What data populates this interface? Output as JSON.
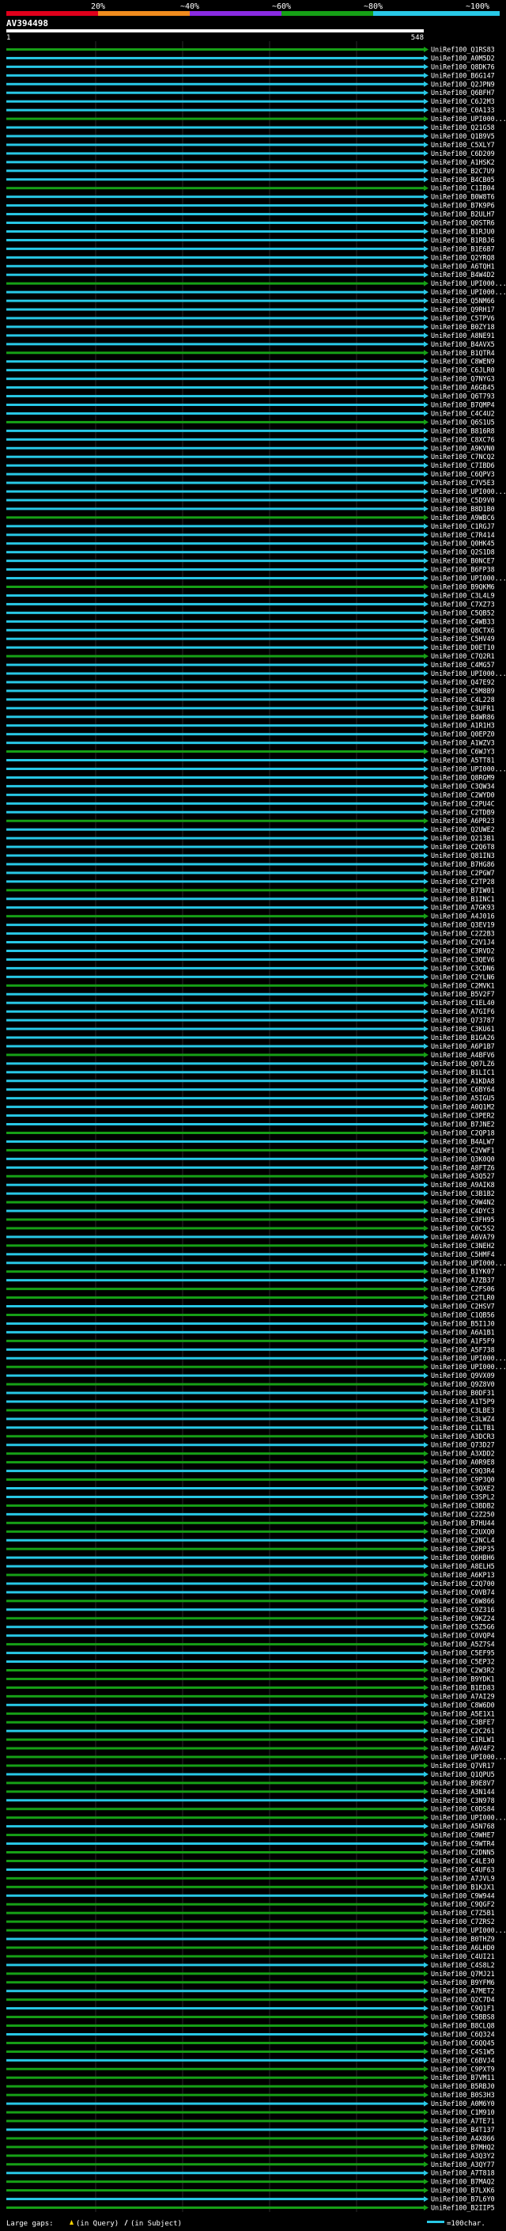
{
  "chart_data": {
    "type": "alignment-overview",
    "query_id": "AV394498",
    "query_start": "1",
    "query_end": "548",
    "identity_scale": {
      "labels": [
        "20%",
        "~40%",
        "~60%",
        "~80%",
        "~100%"
      ],
      "colors": [
        "#e0001b",
        "#f08c1e",
        "#8a2be2",
        "#16a016",
        "#28c8e6"
      ]
    },
    "footer": {
      "large_gaps_label": "Large gaps:",
      "gap_query_label": "(in Query)",
      "gap_subject_label": "(in Subject)",
      "scale_note": "=100char."
    },
    "subjects": [
      "UniRef100_Q1RS83",
      "UniRef100_A0M5D2",
      "UniRef100_Q8DK76",
      "UniRef100_B6G147",
      "UniRef100_Q2JPN9",
      "UniRef100_Q6BFH7",
      "UniRef100_C6J2M3",
      "UniRef100_C0A133",
      "UniRef100_UPI000...",
      "UniRef100_Q21G58",
      "UniRef100_Q1B9V5",
      "UniRef100_C5XLY7",
      "UniRef100_C6D209",
      "UniRef100_A1HSK2",
      "UniRef100_B2C7U9",
      "UniRef100_B4CB05",
      "UniRef100_C1IB04",
      "UniRef100_B0W8T6",
      "UniRef100_B7K9P6",
      "UniRef100_B2ULH7",
      "UniRef100_Q0STR6",
      "UniRef100_B1RJU0",
      "UniRef100_B1RBJ6",
      "UniRef100_B1E6B7",
      "UniRef100_Q2YRQ8",
      "UniRef100_A6TQH1",
      "UniRef100_B4W4D2",
      "UniRef100_UPI000...",
      "UniRef100_UPI000...",
      "UniRef100_Q5NM66",
      "UniRef100_Q9RH17",
      "UniRef100_C5TPV6",
      "UniRef100_B0ZY18",
      "UniRef100_A8NE91",
      "UniRef100_B4AVX5",
      "UniRef100_B1QTR4",
      "UniRef100_C8WEN9",
      "UniRef100_C6JLR0",
      "UniRef100_Q7NYG3",
      "UniRef100_A6GB45",
      "UniRef100_Q6T793",
      "UniRef100_B7QMP4",
      "UniRef100_C4C4U2",
      "UniRef100_Q6S1U5",
      "UniRef100_B816R8",
      "UniRef100_C8XC76",
      "UniRef100_A9KVN0",
      "UniRef100_C7NCQ2",
      "UniRef100_C7IBD6",
      "UniRef100_C6QPV3",
      "UniRef100_C7V5E3",
      "UniRef100_UPI000...",
      "UniRef100_C5D9V0",
      "UniRef100_B8D1B0",
      "UniRef100_A9WBC6",
      "UniRef100_C1RGJ7",
      "UniRef100_C7R414",
      "UniRef100_Q0HK45",
      "UniRef100_Q2S1D8",
      "UniRef100_B0NCE7",
      "UniRef100_B6FP38",
      "UniRef100_UPI000...",
      "UniRef100_B9QKM6",
      "UniRef100_C3L4L9",
      "UniRef100_C7XZ73",
      "UniRef100_C5QB52",
      "UniRef100_C4WB33",
      "UniRef100_Q8CTX6",
      "UniRef100_C5HV49",
      "UniRef100_D0ET10",
      "UniRef100_C7Q2R1",
      "UniRef100_C4MG57",
      "UniRef100_UPI000...",
      "UniRef100_Q47E92",
      "UniRef100_C5M8B9",
      "UniRef100_C4L228",
      "UniRef100_C3UFR1",
      "UniRef100_B4WR86",
      "UniRef100_A1R1H3",
      "UniRef100_Q0EPZ0",
      "UniRef100_A1WZV3",
      "UniRef100_C6WJY3",
      "UniRef100_A5TT81",
      "UniRef100_UPI000...",
      "UniRef100_Q8RGM9",
      "UniRef100_C3QW34",
      "UniRef100_C2WYD0",
      "UniRef100_C2PU4C",
      "UniRef100_C2TDB9",
      "UniRef100_A6PR23",
      "UniRef100_Q2UWE2",
      "UniRef100_Q213B1",
      "UniRef100_C2Q6T8",
      "UniRef100_Q81IN3",
      "UniRef100_B7HG86",
      "UniRef100_C2PGW7",
      "UniRef100_C2TP28",
      "UniRef100_B7IW01",
      "UniRef100_B1INC1",
      "UniRef100_A7GK93",
      "UniRef100_A4J016",
      "UniRef100_Q3EV19",
      "UniRef100_C2Z2B3",
      "UniRef100_C2V1J4",
      "UniRef100_C3RVD2",
      "UniRef100_C3QEV6",
      "UniRef100_C3CDN6",
      "UniRef100_C2YLN6",
      "UniRef100_C2MVK1",
      "UniRef100_B5V2F7",
      "UniRef100_C1EL40",
      "UniRef100_A7GIF6",
      "UniRef100_Q73787",
      "UniRef100_C3KU61",
      "UniRef100_B1GA26",
      "UniRef100_A6P1B7",
      "UniRef100_A4BFV6",
      "UniRef100_Q07LZ6",
      "UniRef100_B1LIC1",
      "UniRef100_A1KDA8",
      "UniRef100_C6BY64",
      "UniRef100_A5IGU5",
      "UniRef100_A0Q1M2",
      "UniRef100_C3PER2",
      "UniRef100_B7JNE2",
      "UniRef100_C2QP18",
      "UniRef100_B4ALW7",
      "UniRef100_C2VWF1",
      "UniRef100_Q3K0Q0",
      "UniRef100_A8FTZ6",
      "UniRef100_A3Q527",
      "UniRef100_A9AIK8",
      "UniRef100_C3B1B2",
      "UniRef100_C9W4N2",
      "UniRef100_C4DYC3",
      "UniRef100_C3FH95",
      "UniRef100_C0C5S2",
      "UniRef100_A6VA79",
      "UniRef100_C3NEH2",
      "UniRef100_C5HMF4",
      "UniRef100_UPI000...",
      "UniRef100_B1YK07",
      "UniRef100_A7ZB37",
      "UniRef100_C2FS06",
      "UniRef100_C2TLR0",
      "UniRef100_C2HSV7",
      "UniRef100_C1QB56",
      "UniRef100_B5I1J0",
      "UniRef100_A6A1B1",
      "UniRef100_A1F5F9",
      "UniRef100_A5F738",
      "UniRef100_UPI000...",
      "UniRef100_UPI000...",
      "UniRef100_Q9VX09",
      "UniRef100_Q9Z8V0",
      "UniRef100_B0DF31",
      "UniRef100_A1T5P9",
      "UniRef100_C3LBE3",
      "UniRef100_C3LWZ4",
      "UniRef100_C1LTB1",
      "UniRef100_A3DCR3",
      "UniRef100_Q73D27",
      "UniRef100_A3XDD2",
      "UniRef100_A0R9E8",
      "UniRef100_C9Q3R4",
      "UniRef100_C9P3Q0",
      "UniRef100_C3QXE2",
      "UniRef100_C3SPL2",
      "UniRef100_C3BDB2",
      "UniRef100_C2Z250",
      "UniRef100_B7HU44",
      "UniRef100_C2UXQ0",
      "UniRef100_C2NCL4",
      "UniRef100_C2RP35",
      "UniRef100_Q6HBH6",
      "UniRef100_A8ELH5",
      "UniRef100_A6KP13",
      "UniRef100_C2Q700",
      "UniRef100_C0VB74",
      "UniRef100_C6W866",
      "UniRef100_C9Z316",
      "UniRef100_C9KZ24",
      "UniRef100_C5Z5G6",
      "UniRef100_C0VQP4",
      "UniRef100_A5Z7S4",
      "UniRef100_C5EF95",
      "UniRef100_C5EP32",
      "UniRef100_C2W3R2",
      "UniRef100_B9YDK1",
      "UniRef100_B1ED83",
      "UniRef100_A7AI29",
      "UniRef100_C8W6D0",
      "UniRef100_A5E1X1",
      "UniRef100_C3BFE7",
      "UniRef100_C2C261",
      "UniRef100_C1RLW1",
      "UniRef100_A6V4F2",
      "UniRef100_UPI000...",
      "UniRef100_Q7VR17",
      "UniRef100_Q1QPU5",
      "UniRef100_B9E8V7",
      "UniRef100_A3N144",
      "UniRef100_C3N978",
      "UniRef100_C0DS84",
      "UniRef100_UPI000...",
      "UniRef100_A5N768",
      "UniRef100_C9WHE7",
      "UniRef100_C9WTR4",
      "UniRef100_C2DNN5",
      "UniRef100_C4LE30",
      "UniRef100_C4UF63",
      "UniRef100_A7JVL9",
      "UniRef100_B1KJX1",
      "UniRef100_C9W944",
      "UniRef100_C9QGF2",
      "UniRef100_C7Z5B1",
      "UniRef100_C7ZRS2",
      "UniRef100_UPI000...",
      "UniRef100_B0THZ9",
      "UniRef100_A6LHD0",
      "UniRef100_C4UI21",
      "UniRef100_C4S8L2",
      "UniRef100_Q7MJ21",
      "UniRef100_B9YFM6",
      "UniRef100_A7MET2",
      "UniRef100_Q2C7D4",
      "UniRef100_C9Q1F1",
      "UniRef100_C5BBS8",
      "UniRef100_B8CLQ8",
      "UniRef100_C6Q324",
      "UniRef100_C6QQ45",
      "UniRef100_C4S1W5",
      "UniRef100_C6BVJ4",
      "UniRef100_C9PXT9",
      "UniRef100_B7VM11",
      "UniRef100_B5RBJ0",
      "UniRef100_B0S3H3",
      "UniRef100_A0M6Y0",
      "UniRef100_C1M910",
      "UniRef100_A7TE71",
      "UniRef100_B4T137",
      "UniRef100_A4X866",
      "UniRef100_B7MHQ2",
      "UniRef100_A3Q3Y2",
      "UniRef100_A3QY77",
      "UniRef100_A7T818",
      "UniRef100_B7MAQ2",
      "UniRef100_B7LXK6",
      "UniRef100_B7L6Y0",
      "UniRef100_B2IIP5"
    ]
  }
}
